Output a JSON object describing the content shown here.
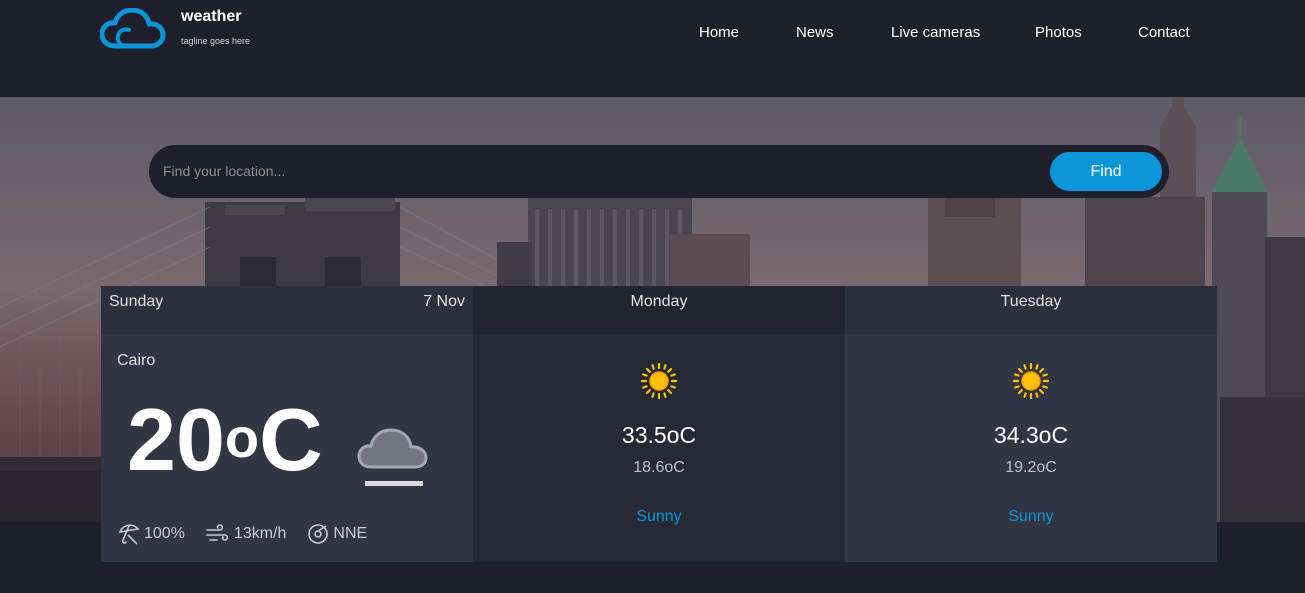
{
  "brand": {
    "title": "weather",
    "tagline": "tagline goes here",
    "icon": "cloud-icon",
    "accent": "#0d95da"
  },
  "nav": {
    "items": [
      {
        "label": "Home"
      },
      {
        "label": "News"
      },
      {
        "label": "Live cameras"
      },
      {
        "label": "Photos"
      },
      {
        "label": "Contact"
      }
    ]
  },
  "search": {
    "placeholder": "Find your location...",
    "button_label": "Find"
  },
  "forecast": {
    "today": {
      "day": "Sunday",
      "date": "7 Nov",
      "location": "Cairo",
      "temp": "20",
      "temp_unit_deg": "o",
      "temp_unit": "C",
      "icon": "cloud-fog-icon",
      "humidity": "100%",
      "wind_speed": "13km/h",
      "wind_direction": "NNE"
    },
    "days": [
      {
        "day": "Monday",
        "icon": "sun-icon",
        "max_temp": "33.5",
        "max_unit": "oC",
        "min_temp": "18.6",
        "min_unit": "oC",
        "condition": "Sunny"
      },
      {
        "day": "Tuesday",
        "icon": "sun-icon",
        "max_temp": "34.3",
        "max_unit": "oC",
        "min_temp": "19.2",
        "min_unit": "oC",
        "condition": "Sunny"
      }
    ]
  },
  "colors": {
    "background": "#1e202b",
    "panel": "#323544",
    "panel_alt": "#262936",
    "sun": "#ffc107"
  }
}
